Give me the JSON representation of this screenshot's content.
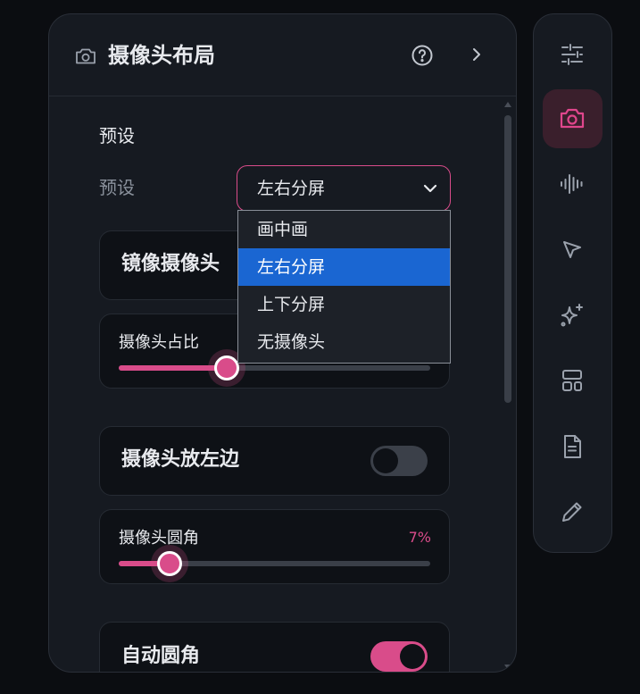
{
  "header": {
    "title": "摄像头布局",
    "camera_icon": "camera-icon",
    "help_icon": "help-circle-icon",
    "next_icon": "chevron-right-icon"
  },
  "preset": {
    "section_title": "预设",
    "label": "预设",
    "selected": "左右分屏",
    "options": [
      "画中画",
      "左右分屏",
      "上下分屏",
      "无摄像头"
    ]
  },
  "mirror": {
    "label": "镜像摄像头"
  },
  "camera_ratio": {
    "label": "摄像头占比",
    "value_fraction": 0.347
  },
  "camera_left": {
    "label": "摄像头放左边",
    "enabled": false
  },
  "corner_radius": {
    "label": "摄像头圆角",
    "value": "7%",
    "value_fraction": 0.163
  },
  "auto_corner": {
    "label": "自动圆角",
    "enabled": true
  },
  "sidebar": {
    "items": [
      {
        "name": "sliders-icon",
        "active": false
      },
      {
        "name": "camera-icon",
        "active": true
      },
      {
        "name": "audio-waveform-icon",
        "active": false
      },
      {
        "name": "cursor-pointer-icon",
        "active": false
      },
      {
        "name": "sparkles-icon",
        "active": false
      },
      {
        "name": "layout-icon",
        "active": false
      },
      {
        "name": "document-icon",
        "active": false
      },
      {
        "name": "pencil-icon",
        "active": false
      }
    ]
  },
  "colors": {
    "accent": "#d94c8a",
    "panel_bg": "#161a21",
    "card_bg": "#0e1116",
    "selected_option": "#1a66d2"
  }
}
